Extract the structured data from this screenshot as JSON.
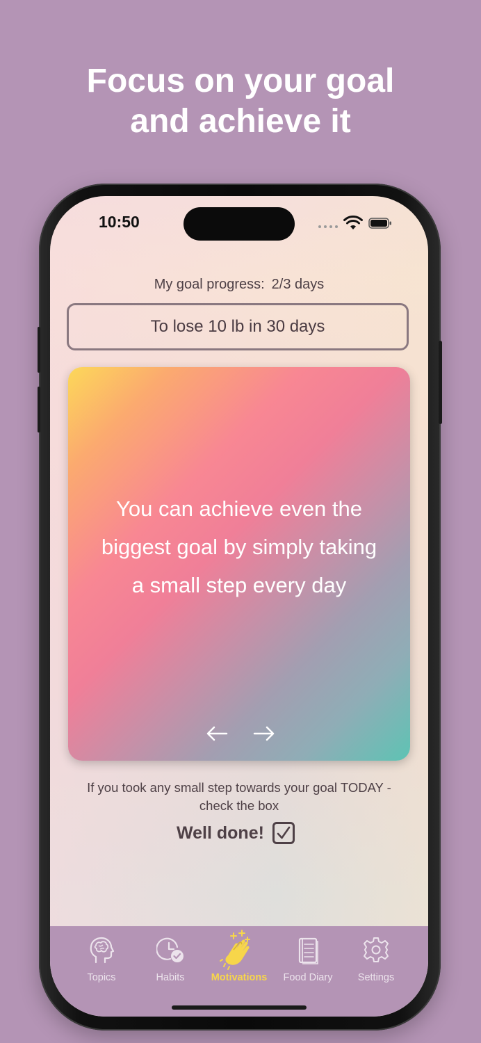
{
  "headline": {
    "line1": "Focus on your goal",
    "line2": "and achieve it"
  },
  "status_bar": {
    "time": "10:50"
  },
  "goal": {
    "progress_label": "My goal progress:",
    "progress_value": "2/3 days",
    "description": "To lose 10 lb  in 30 days"
  },
  "motivation_card": {
    "quote_lines": [
      "You can achieve even the",
      "biggest goal by simply taking",
      "a small step every day"
    ],
    "prev_icon": "arrow-left-icon",
    "next_icon": "arrow-right-icon"
  },
  "daily_check": {
    "hint_lines": [
      "If you took any small step towards your goal TODAY -",
      "check the box"
    ],
    "label": "Well done!",
    "checked": true
  },
  "tabs": [
    {
      "label": "Topics",
      "icon": "brain-head-icon",
      "active": false
    },
    {
      "label": "Habits",
      "icon": "clock-check-icon",
      "active": false
    },
    {
      "label": "Motivations",
      "icon": "clapping-hands-icon",
      "active": true
    },
    {
      "label": "Food Diary",
      "icon": "notebook-icon",
      "active": false
    },
    {
      "label": "Settings",
      "icon": "gear-icon",
      "active": false
    }
  ],
  "colors": {
    "background": "#b494b5",
    "active_tab": "#f7d64a",
    "text_dark": "#4e4046"
  }
}
